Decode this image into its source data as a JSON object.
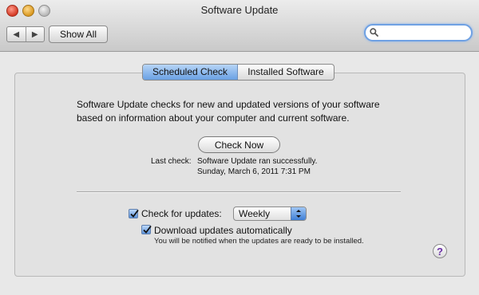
{
  "window": {
    "title": "Software Update"
  },
  "toolbar": {
    "back_icon": "◀",
    "forward_icon": "▶",
    "show_all_label": "Show All",
    "search_value": ""
  },
  "tabs": [
    {
      "label": "Scheduled Check",
      "selected": true
    },
    {
      "label": "Installed Software",
      "selected": false
    }
  ],
  "scheduled": {
    "description_line1": "Software Update checks for new and updated versions of your software",
    "description_line2": "based on information about your computer and current software.",
    "check_now_label": "Check Now",
    "last_check_label": "Last check:",
    "last_check_status": "Software Update ran successfully.",
    "last_check_date": "Sunday, March 6, 2011 7:31 PM",
    "check_for_updates_label": "Check for updates:",
    "check_for_updates_checked": true,
    "frequency_value": "Weekly",
    "download_auto_label": "Download updates automatically",
    "download_auto_checked": true,
    "download_note": "You will be notified when the updates are ready to be installed."
  },
  "help": {
    "label": "?"
  },
  "colors": {
    "accent": "#5c93da",
    "help_glyph": "#6b2fa6"
  }
}
